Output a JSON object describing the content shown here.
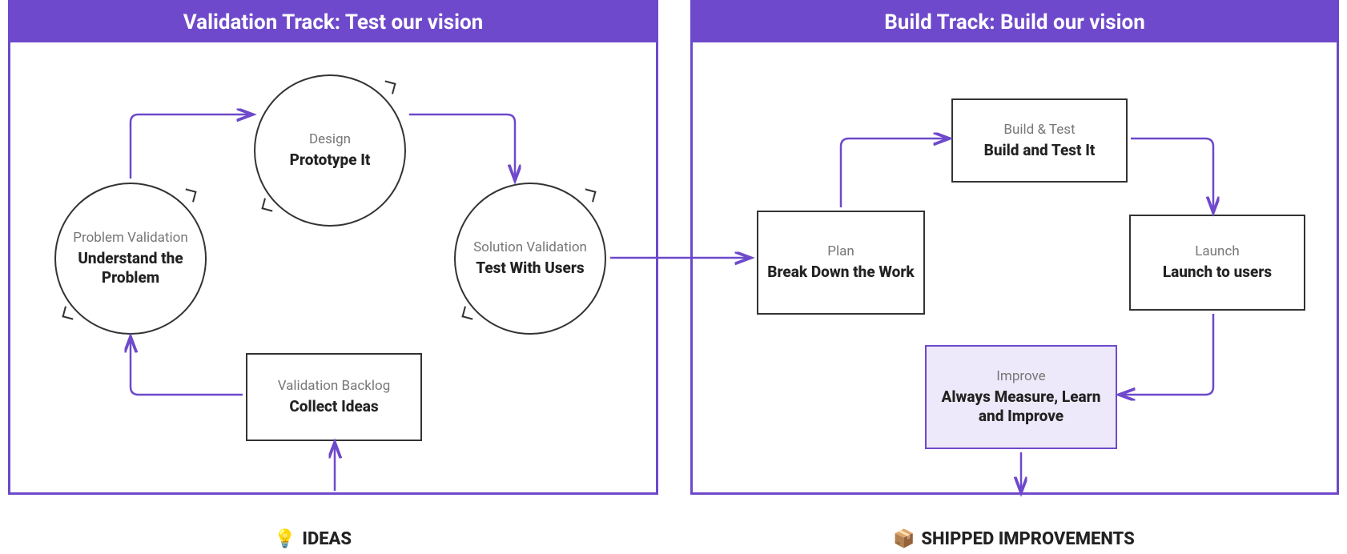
{
  "validation_track": {
    "header": "Validation Track: Test our vision",
    "nodes": {
      "problem_validation": {
        "subtitle": "Problem Validation",
        "title": "Understand the Problem"
      },
      "design": {
        "subtitle": "Design",
        "title": "Prototype It"
      },
      "solution_validation": {
        "subtitle": "Solution Validation",
        "title": "Test With Users"
      },
      "backlog": {
        "subtitle": "Validation Backlog",
        "title": "Collect Ideas"
      }
    },
    "footer": {
      "icon": "💡",
      "label": "IDEAS"
    }
  },
  "build_track": {
    "header": "Build Track: Build our vision",
    "nodes": {
      "plan": {
        "subtitle": "Plan",
        "title": "Break Down the Work"
      },
      "build_test": {
        "subtitle": "Build & Test",
        "title": "Build and Test It"
      },
      "launch": {
        "subtitle": "Launch",
        "title": "Launch to users"
      },
      "improve": {
        "subtitle": "Improve",
        "title": "Always Measure, Learn and Improve"
      }
    },
    "footer": {
      "icon": "📦",
      "label": "SHIPPED IMPROVEMENTS"
    }
  },
  "colors": {
    "primary": "#6e49cb",
    "highlight_bg": "#eee9fa"
  }
}
